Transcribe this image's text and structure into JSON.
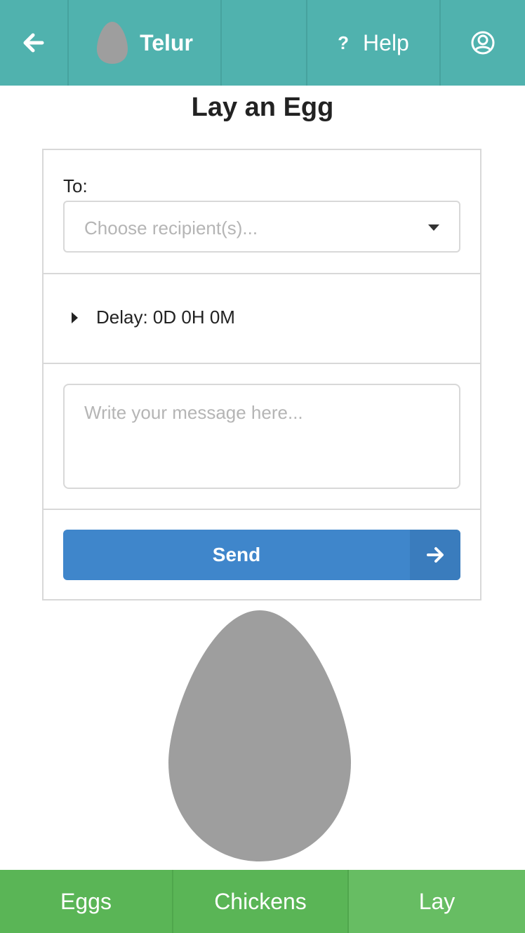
{
  "header": {
    "back_icon": "arrow-left-icon",
    "brand": {
      "name": "Telur",
      "logo": "egg-icon",
      "logo_color": "#9e9e9e"
    },
    "help": {
      "icon": "question-icon",
      "icon_text": "?",
      "label": "Help"
    },
    "account_icon": "user-circle-icon",
    "background_color": "#50b2ae"
  },
  "page": {
    "title": "Lay an Egg"
  },
  "form": {
    "to_label": "To:",
    "recipient_placeholder": "Choose recipient(s)...",
    "delay_label": "Delay: 0D 0H 0M",
    "message_placeholder": "Write your message here...",
    "send_label": "Send",
    "send_color": "#3f86cb"
  },
  "illustration": {
    "icon": "egg-icon",
    "color": "#9e9e9e"
  },
  "bottom_nav": {
    "items": [
      {
        "label": "Eggs",
        "active": false
      },
      {
        "label": "Chickens",
        "active": false
      },
      {
        "label": "Lay",
        "active": true
      }
    ],
    "color": "#5ab556",
    "active_color": "#67bd63"
  }
}
